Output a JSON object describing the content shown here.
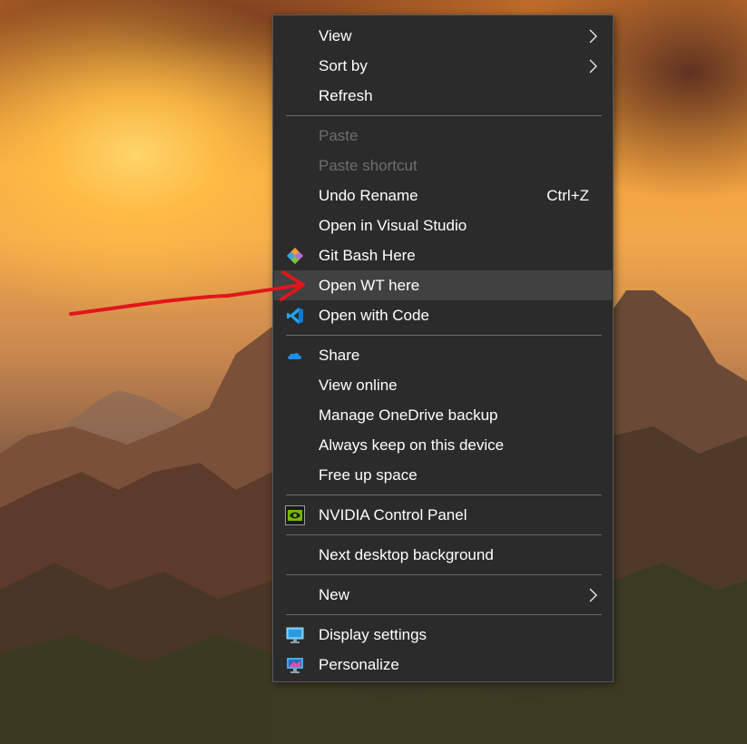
{
  "context_menu": {
    "items": [
      {
        "label": "View",
        "submenu": true
      },
      {
        "label": "Sort by",
        "submenu": true
      },
      {
        "label": "Refresh"
      },
      {
        "label": "Paste",
        "disabled": true
      },
      {
        "label": "Paste shortcut",
        "disabled": true
      },
      {
        "label": "Undo Rename",
        "shortcut": "Ctrl+Z"
      },
      {
        "label": "Open in Visual Studio"
      },
      {
        "label": "Git Bash Here",
        "icon": "git-bash-icon"
      },
      {
        "label": "Open WT here",
        "highlighted": true
      },
      {
        "label": "Open with Code",
        "icon": "vscode-icon"
      },
      {
        "label": "Share",
        "icon": "onedrive-cloud-icon"
      },
      {
        "label": "View online"
      },
      {
        "label": "Manage OneDrive backup"
      },
      {
        "label": "Always keep on this device"
      },
      {
        "label": "Free up space"
      },
      {
        "label": "NVIDIA Control Panel",
        "icon": "nvidia-icon"
      },
      {
        "label": "Next desktop background"
      },
      {
        "label": "New",
        "submenu": true
      },
      {
        "label": "Display settings",
        "icon": "display-settings-icon"
      },
      {
        "label": "Personalize",
        "icon": "personalize-icon"
      }
    ]
  },
  "colors": {
    "menu_background": "#2b2b2b",
    "menu_highlight": "#414141",
    "text": "#ffffff",
    "disabled_text": "#6d6d6d",
    "annotation_arrow": "#e0161b"
  }
}
